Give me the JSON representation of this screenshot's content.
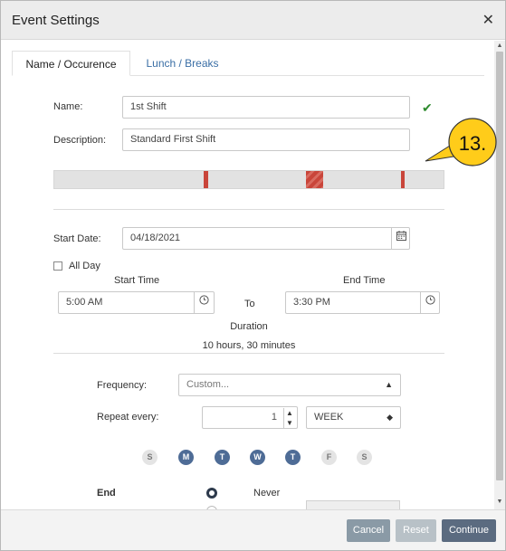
{
  "dialog": {
    "title": "Event Settings",
    "close_glyph": "✕"
  },
  "tabs": [
    {
      "label": "Name / Occurence",
      "active": true
    },
    {
      "label": "Lunch / Breaks",
      "active": false
    }
  ],
  "form": {
    "name_label": "Name:",
    "name_value": "1st Shift",
    "description_label": "Description:",
    "description_value": "Standard First Shift",
    "start_date_label": "Start Date:",
    "start_date_value": "04/18/2021",
    "all_day_label": "All Day",
    "start_time_label": "Start Time",
    "end_time_label": "End Time",
    "start_time_value": "5:00 AM",
    "to_label": "To",
    "end_time_value": "3:30 PM",
    "duration_label": "Duration",
    "duration_value": "10 hours, 30 minutes",
    "frequency_label": "Frequency:",
    "frequency_value": "Custom...",
    "repeat_label": "Repeat every:",
    "repeat_value": "1",
    "repeat_unit": "WEEK",
    "end_label": "End",
    "never_label": "Never"
  },
  "days": [
    {
      "letter": "S",
      "selected": false
    },
    {
      "letter": "M",
      "selected": true
    },
    {
      "letter": "T",
      "selected": true
    },
    {
      "letter": "W",
      "selected": true
    },
    {
      "letter": "T",
      "selected": true
    },
    {
      "letter": "F",
      "selected": false
    },
    {
      "letter": "S",
      "selected": false
    }
  ],
  "timeline_segments": [
    {
      "start_fraction": 0.383,
      "width_fraction": 0.012,
      "style": "solid"
    },
    {
      "start_fraction": 0.647,
      "width_fraction": 0.044,
      "style": "striped"
    },
    {
      "start_fraction": 0.891,
      "width_fraction": 0.009,
      "style": "solid"
    }
  ],
  "annotation": {
    "label": "13."
  },
  "footer": {
    "cancel": "Cancel",
    "reset": "Reset",
    "continue": "Continue"
  },
  "colors": {
    "accent": "#4e6c96",
    "segment": "#c9453a",
    "success_check": "#2e8b2e",
    "callout_fill": "#ffcc1a",
    "cancel_button": "#8a9aa6",
    "reset_button": "#b8c1c7",
    "continue_button": "#5b6b80"
  },
  "icons": {
    "close": "close-icon",
    "valid": "checkmark-icon",
    "calendar": "calendar-icon",
    "clock": "clock-icon",
    "caret": "caret-updown-icon"
  }
}
